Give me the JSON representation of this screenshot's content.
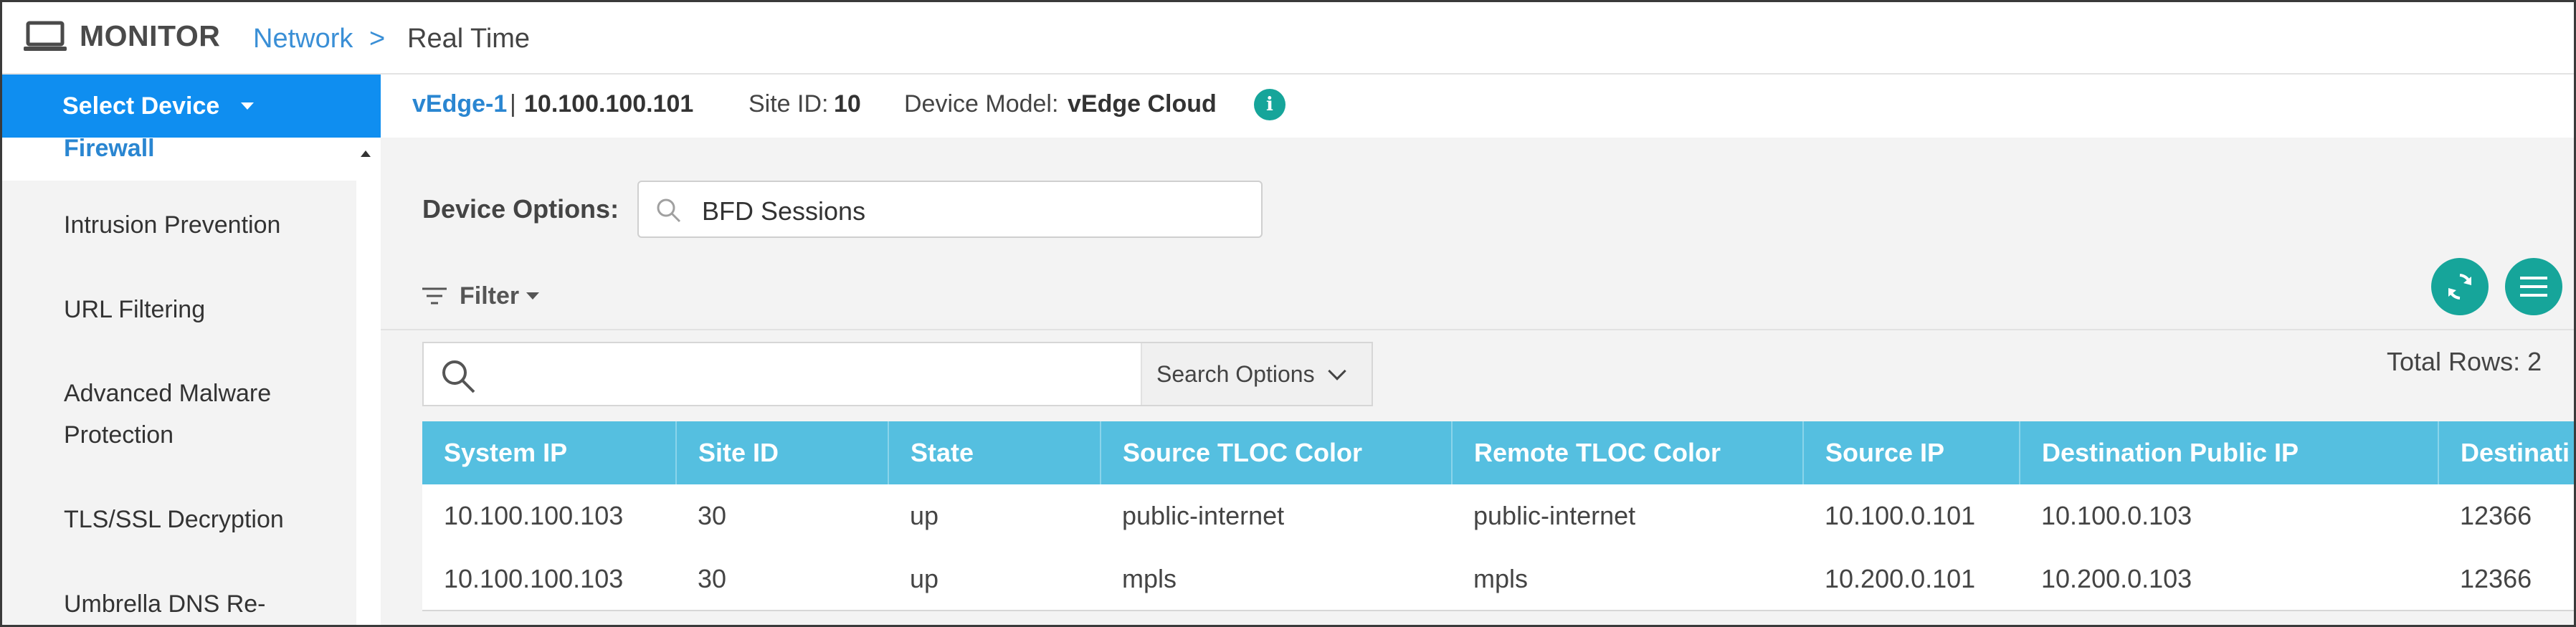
{
  "header": {
    "title": "MONITOR",
    "breadcrumb": {
      "link": "Network",
      "separator": ">",
      "current": "Real Time"
    }
  },
  "sidebar": {
    "select_device_label": "Select Device",
    "items": [
      {
        "label": "Firewall",
        "active": true
      },
      {
        "label": "Intrusion Prevention"
      },
      {
        "label": "URL Filtering"
      },
      {
        "label": "Advanced Malware"
      },
      {
        "label": "Protection"
      },
      {
        "label": "TLS/SSL Decryption"
      },
      {
        "label": "Umbrella DNS Re-"
      }
    ]
  },
  "device_info": {
    "name": "vEdge-1",
    "separator": "|",
    "ip": "10.100.100.101",
    "site_label": "Site ID:",
    "site_id": "10",
    "model_label": "Device Model:",
    "model": "vEdge Cloud",
    "info_icon": "info-icon"
  },
  "device_options": {
    "label": "Device Options:",
    "value": "BFD Sessions"
  },
  "filter": {
    "label": "Filter"
  },
  "search": {
    "placeholder": "",
    "options_label": "Search Options"
  },
  "total_rows": "Total Rows: 2",
  "table": {
    "columns": [
      "System IP",
      "Site ID",
      "State",
      "Source TLOC Color",
      "Remote TLOC Color",
      "Source IP",
      "Destination Public IP",
      "Destinati"
    ],
    "rows": [
      [
        "10.100.100.103",
        "30",
        "up",
        "public-internet",
        "public-internet",
        "10.100.0.101",
        "10.100.0.103",
        "12366"
      ],
      [
        "10.100.100.103",
        "30",
        "up",
        "mpls",
        "mpls",
        "10.200.0.101",
        "10.200.0.103",
        "12366"
      ]
    ]
  },
  "colors": {
    "accent_blue": "#0f8ef0",
    "link_blue": "#2a86d1",
    "teal": "#16a59a",
    "table_header": "#55bfe0"
  }
}
